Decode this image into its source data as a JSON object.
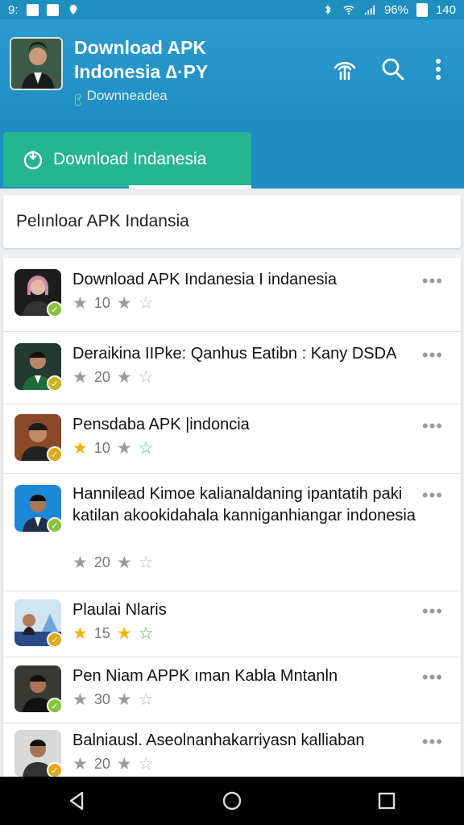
{
  "status_bar": {
    "time": "140",
    "left_text": "9:",
    "battery": "96%"
  },
  "app_bar": {
    "title": "Download APK Indonesia ∆·PY",
    "subtitle_prefix": "၉",
    "subtitle": "Downneadea",
    "actions": [
      "antenna-icon",
      "search-icon",
      "more-vert-icon"
    ]
  },
  "tabs": {
    "active_label": "Download Indanesia"
  },
  "search": {
    "text": "Pelınloaɾ APK Indansia"
  },
  "items": [
    {
      "title": "Download APK Indanesia I indanesia",
      "rating": "10",
      "stars": [
        "gray",
        "gray",
        "outline"
      ],
      "badge_color": "#8ac43f",
      "icon_bg": "#1c1c1c"
    },
    {
      "title": "Deraikina IIPke: Qanhus Eatibn : Kany DSDA",
      "rating": "20",
      "stars": [
        "gray",
        "gray",
        "outline"
      ],
      "badge_color": "#c8b51e",
      "icon_bg": "#1f2f2a"
    },
    {
      "title": "Pensdaba APK |indoncia",
      "rating": "10",
      "stars": [
        "gold",
        "gray",
        "teal"
      ],
      "badge_color": "#e0a81b",
      "icon_bg": "#7a2d22"
    },
    {
      "title": "Hannilead Kimoe kalianaldaning ipantatih paki katilan akookidahala kanniganhiangar indonesia",
      "rating": "20",
      "stars": [
        "gray",
        "gray",
        "outline"
      ],
      "badge_color": "#8ac43f",
      "icon_bg": "#1e88d8"
    },
    {
      "title": "Plaulai Nlaris",
      "rating": "15",
      "stars": [
        "gold",
        "gold",
        "green"
      ],
      "badge_color": "#e0a81b",
      "icon_bg": "#3a9ad6"
    },
    {
      "title": "Pen Niam APPK ıman Kabla Mntanln",
      "rating": "30",
      "stars": [
        "gray",
        "gray",
        "outline"
      ],
      "badge_color": "#8ac43f",
      "icon_bg": "#2a2a2a"
    },
    {
      "title": "Balniausl. Aseolnanhakarriyasn kalliaban",
      "rating": "20",
      "stars": [
        "gray",
        "gray",
        "outline"
      ],
      "badge_color": "#e0a81b",
      "icon_bg": "#7a7a7a"
    }
  ],
  "nav": [
    "back-icon",
    "home-icon",
    "recents-icon"
  ]
}
